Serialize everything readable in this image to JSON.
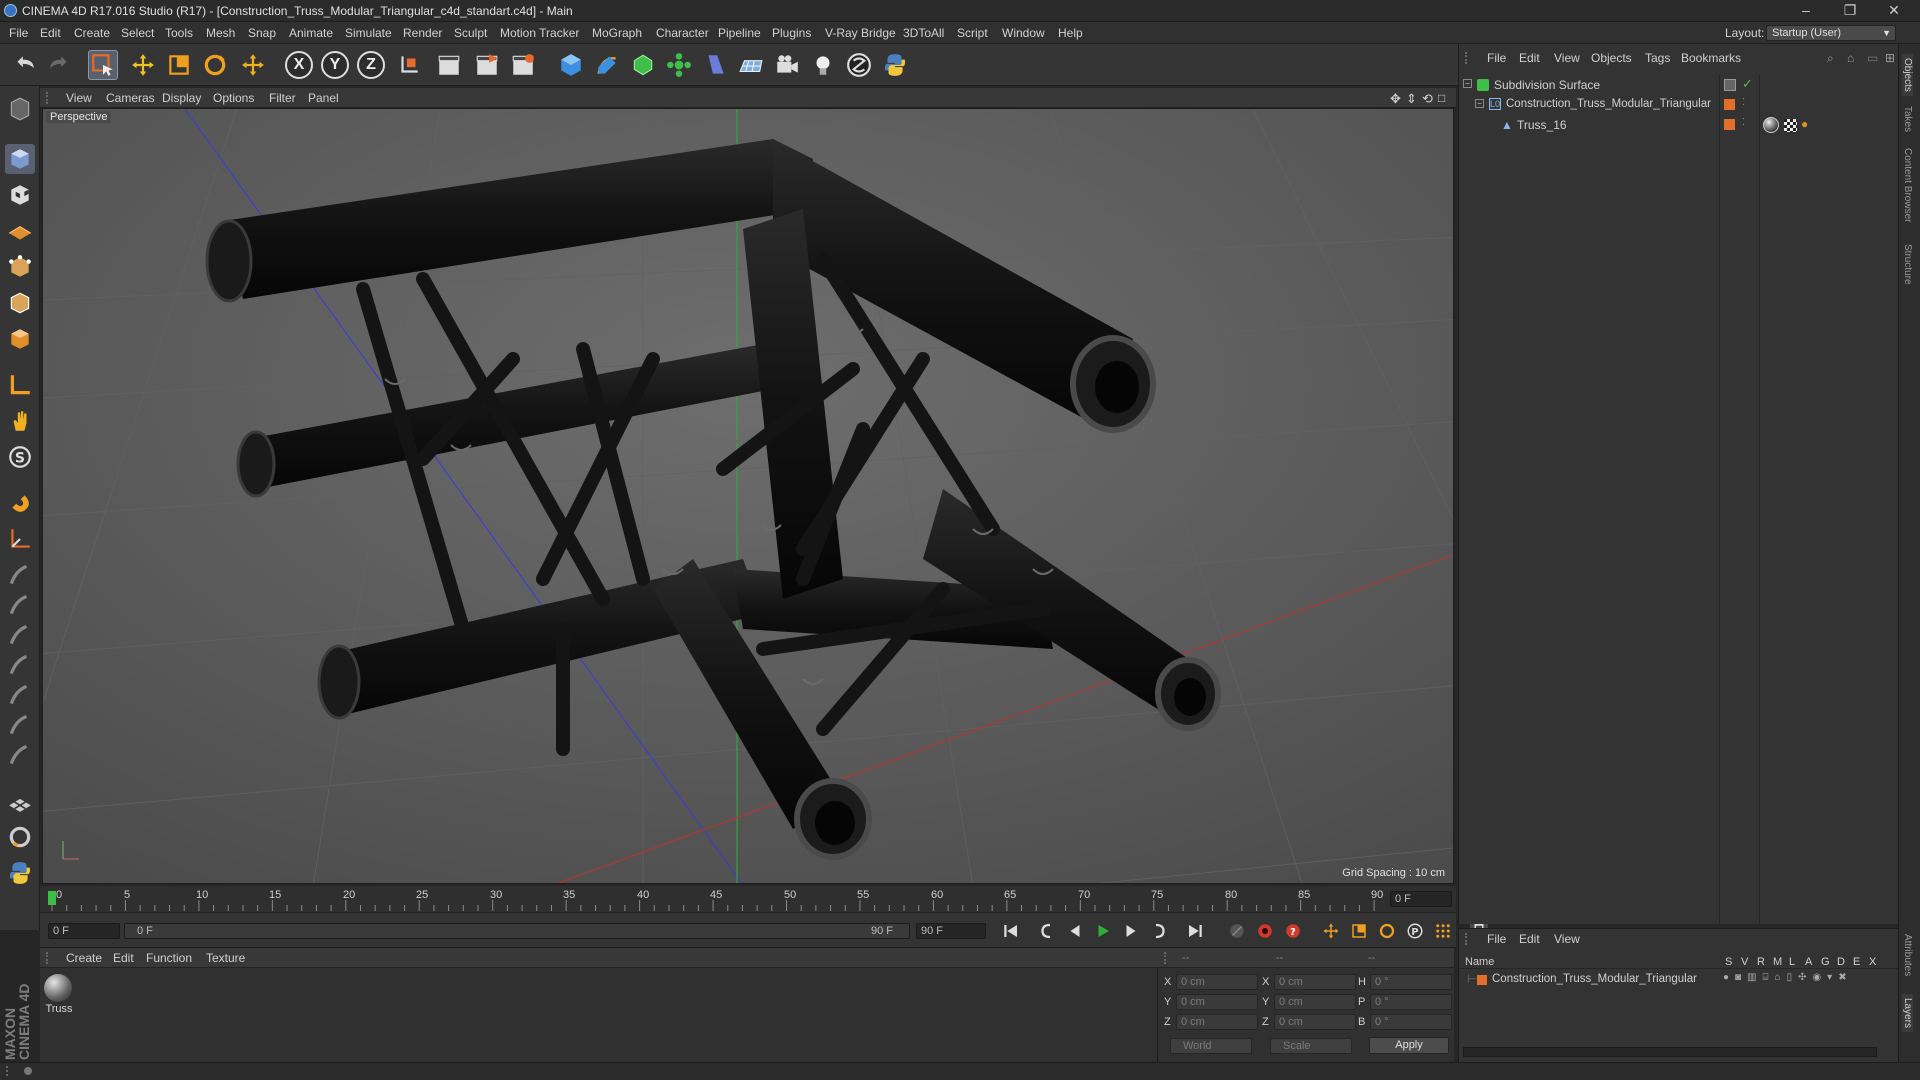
{
  "window": {
    "title": "CINEMA 4D R17.016 Studio (R17) - [Construction_Truss_Modular_Triangular_c4d_standart.c4d] - Main",
    "controls": [
      "–",
      "❐",
      "✕"
    ]
  },
  "menubar": {
    "items": [
      "File",
      "Edit",
      "Create",
      "Select",
      "Tools",
      "Mesh",
      "Snap",
      "Animate",
      "Simulate",
      "Render",
      "Sculpt",
      "Motion Tracker",
      "MoGraph",
      "Character",
      "Pipeline",
      "Plugins",
      "V-Ray Bridge",
      "3DToAll",
      "Script",
      "Window",
      "Help"
    ],
    "layout_label": "Layout:",
    "layout_value": "Startup (User)"
  },
  "toolbar": {
    "axis_x": "X",
    "axis_y": "Y",
    "axis_z": "Z"
  },
  "viewport": {
    "menu": [
      "View",
      "Cameras",
      "Display",
      "Options",
      "Filter",
      "Panel"
    ],
    "label": "Perspective",
    "grid_spacing": "Grid Spacing : 10 cm"
  },
  "timeline": {
    "ticks": [
      "0",
      "5",
      "10",
      "15",
      "20",
      "25",
      "30",
      "35",
      "40",
      "45",
      "50",
      "55",
      "60",
      "65",
      "70",
      "75",
      "80",
      "85",
      "90"
    ],
    "current_frame_display": "0 F",
    "start_field": "0 F",
    "range_start": "0 F",
    "range_end": "90 F",
    "end_field": "90 F"
  },
  "material_manager": {
    "menu": [
      "Create",
      "Edit",
      "Function",
      "Texture"
    ],
    "material_name": "Truss"
  },
  "coordinates": {
    "header_a": "--",
    "header_b": "--",
    "header_c": "--",
    "rows": [
      {
        "label": "X",
        "pos": "0 cm",
        "label2": "X",
        "size": "0 cm",
        "label3": "H",
        "rot": "0 °"
      },
      {
        "label": "Y",
        "pos": "0 cm",
        "label2": "Y",
        "size": "0 cm",
        "label3": "P",
        "rot": "0 °"
      },
      {
        "label": "Z",
        "pos": "0 cm",
        "label2": "Z",
        "size": "0 cm",
        "label3": "B",
        "rot": "0 °"
      }
    ],
    "mode_world": "World",
    "mode_scale": "Scale",
    "apply": "Apply"
  },
  "object_manager": {
    "menu": [
      "File",
      "Edit",
      "View",
      "Objects",
      "Tags",
      "Bookmarks"
    ],
    "objects": [
      {
        "name": "Subdivision Surface"
      },
      {
        "name": "Construction_Truss_Modular_Triangular"
      },
      {
        "name": "Truss_16"
      }
    ]
  },
  "attribute_manager": {
    "menu": [
      "File",
      "Edit",
      "View"
    ],
    "col_name": "Name",
    "cols": [
      "S",
      "V",
      "R",
      "M",
      "L",
      "A",
      "G",
      "D",
      "E",
      "X"
    ],
    "row_name": "Construction_Truss_Modular_Triangular"
  },
  "side_tabs": [
    "Objects",
    "Takes",
    "Content Browser",
    "Structure",
    "Attributes",
    "Layers"
  ],
  "brand": "MAXON CINEMA 4D",
  "colors": {
    "accent_blue": "#4a90d9",
    "layer_orange": "#e0702a",
    "play_green": "#2fae3a",
    "record_red": "#d03a2a"
  }
}
